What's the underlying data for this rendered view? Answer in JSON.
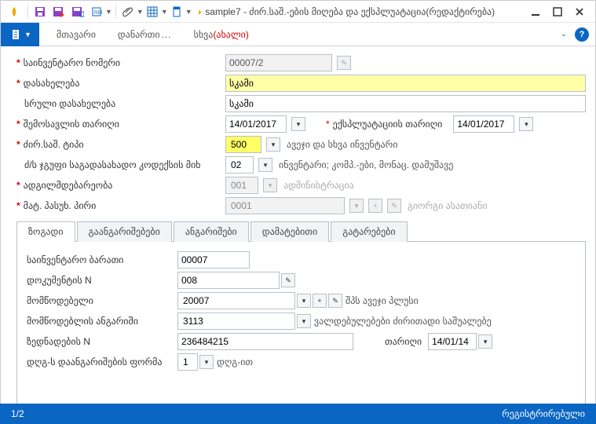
{
  "window": {
    "doc_name": "sample7",
    "title_suffix": " - ძირ.საშ.-ების მიღება და ექსპლუატაცია(რედაქტირება)"
  },
  "menubar": {
    "main": "მთავარი",
    "appendix": "დანართი",
    "dots": "...",
    "other": "სხვა",
    "other_red": "(ახალი)"
  },
  "form": {
    "inventory_number": {
      "label": "საინვენტარო ნომერი",
      "value": "00007/2"
    },
    "name": {
      "label": "დასახელება",
      "value": "სკამი"
    },
    "full_name": {
      "label": "სრული დასახელება",
      "value": "სკამი"
    },
    "income_date": {
      "label": "შემოსავლის თარიღი",
      "value": "14/01/2017"
    },
    "exploit_date": {
      "label": "ექსპლუატაციის თარიღი",
      "value": "14/01/2017"
    },
    "asset_type": {
      "label": "ძირ.საშ. ტიპი",
      "value": "500",
      "desc": "ავეჯი და სხვა ინვენტარი"
    },
    "tax_group": {
      "label": "ძ/ს ჯგუფი საგადასახადო კოდექსის მიხ",
      "value": "02",
      "desc": "ინვენტარი; კომპ.-ები, მონაც. დამუშავე"
    },
    "location": {
      "label": "ადგილმდებარეობა",
      "value": "001",
      "desc": "ადმინისტრაცია"
    },
    "responsible": {
      "label": "მატ. პასუხ. პირი",
      "value": "0001",
      "desc": "გიორგი ასათიანი"
    }
  },
  "tabs": {
    "general": "ზოგადი",
    "calculations": "გაანგარიშებები",
    "accounts": "ანგარიშები",
    "additional": "დამატებითი",
    "postings": "გატარებები"
  },
  "general": {
    "inventory_card": {
      "label": "საინვენტარო ბარათი",
      "value": "00007"
    },
    "doc_n": {
      "label": "დოკუმენტის N",
      "value": "008"
    },
    "supplier": {
      "label": "მომწოდებელი",
      "value": "20007",
      "desc": "შპს ავეჯი პლუსი"
    },
    "supplier_account": {
      "label": "მომწოდებლის ანგარიში",
      "value": "3113",
      "desc": "ვალდებულებები ძირითადი საშუალებე"
    },
    "invoice_n": {
      "label": "ზედნადების N",
      "value": "236484215"
    },
    "invoice_date": {
      "label": "თარიღი",
      "value": "14/01/14"
    },
    "vat_form": {
      "label": "დღგ-ს დაანგარიშების ფორმა",
      "value": "1",
      "desc": "დღგ-ით"
    }
  },
  "footer": {
    "page": "1/2",
    "status": "რეგისტრირებული"
  }
}
